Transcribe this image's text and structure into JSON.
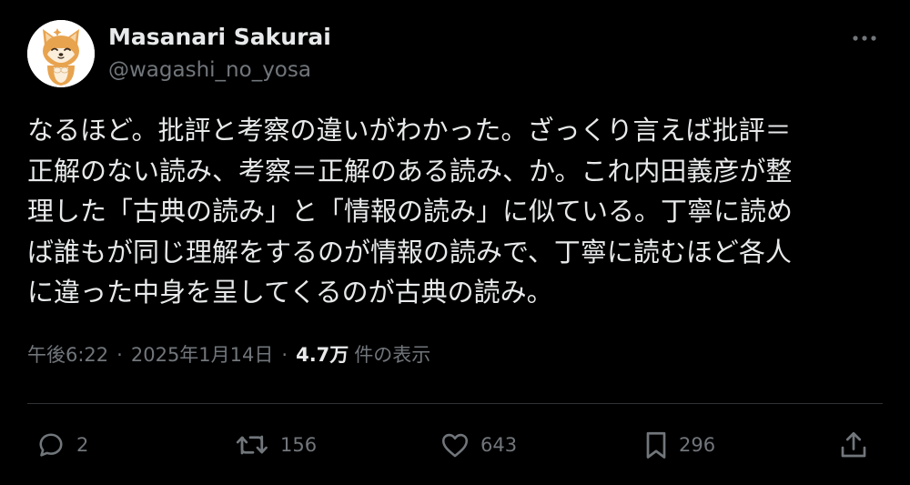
{
  "tweet": {
    "author": {
      "name": "Masanari Sakurai",
      "handle": "@wagashi_no_yosa"
    },
    "text_lines": [
      "なるほど。批評と考察の違いがわかった。ざっくり言えば批評＝",
      "正解のない読み、考察＝正解のある読み、か。これ内田義彦が整",
      "理した「古典の読み」と「情報の読み」に似ている。丁寧に読め",
      "ば誰もが同じ理解をするのが情報の読みで、丁寧に読むほど各人",
      "に違った中身を呈してくるのが古典の読み。"
    ],
    "meta": {
      "time": "午後6:22",
      "separator": "·",
      "date": "2025年1月14日",
      "views_count": "4.7万",
      "views_label": "件の表示"
    }
  },
  "actions": {
    "reply_count": "2",
    "retweet_count": "156",
    "like_count": "643",
    "bookmark_count": "296"
  },
  "icons": {
    "avatar": "shiba-inu-avatar",
    "more": "more-horizontal-icon",
    "reply": "reply-icon",
    "retweet": "retweet-icon",
    "like": "heart-icon",
    "bookmark": "bookmark-icon",
    "share": "share-icon"
  },
  "colors": {
    "background": "#000000",
    "text_primary": "#e7e9ea",
    "text_secondary": "#71767b",
    "divider": "#2f3336"
  }
}
